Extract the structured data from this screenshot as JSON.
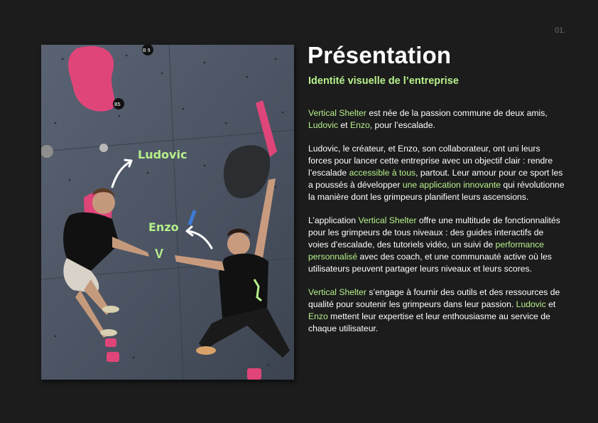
{
  "page_number": "01.",
  "title": "Présentation",
  "subtitle": "Identité visuelle de l’entreprise",
  "photo": {
    "label_ludovic": "Ludovic",
    "label_enzo": "Enzo",
    "hold_tag_b9": "B 9",
    "hold_tag_b5": "B5"
  },
  "paragraphs": [
    {
      "spans": [
        {
          "t": "Vertical Shelter",
          "h": true
        },
        {
          "t": " est née de la passion commune de deux amis, ",
          "h": false
        },
        {
          "t": "Ludovic",
          "h": true
        },
        {
          "t": " et ",
          "h": false
        },
        {
          "t": "Enzo",
          "h": true
        },
        {
          "t": ", pour l’escalade.",
          "h": false
        }
      ]
    },
    {
      "spans": [
        {
          "t": "Ludovic, le créateur, et Enzo, son collaborateur, ont uni leurs forces pour lancer cette entreprise avec un objectif clair : rendre l’escalade ",
          "h": false
        },
        {
          "t": "accessible à tous",
          "h": true
        },
        {
          "t": ", partout. Leur amour pour ce sport les a poussés à développer ",
          "h": false
        },
        {
          "t": "une application innovante",
          "h": true
        },
        {
          "t": " qui révolutionne la manière dont les grimpeurs planifient leurs ascensions.",
          "h": false
        }
      ]
    },
    {
      "spans": [
        {
          "t": "L’application ",
          "h": false
        },
        {
          "t": "Vertical Shelter",
          "h": true
        },
        {
          "t": " offre une multitude de fonctionnalités pour les grimpeurs de tous niveaux : des guides interactifs de voies d’escalade, des tutoriels vidéo, un suivi de ",
          "h": false
        },
        {
          "t": "performance personnalisé",
          "h": true
        },
        {
          "t": " avec des coach, et une communauté active où les utilisateurs peuvent partager leurs niveaux et leurs scores.",
          "h": false
        }
      ]
    },
    {
      "spans": [
        {
          "t": "Vertical Shelter",
          "h": true
        },
        {
          "t": " s’engage à fournir des outils et des ressources de qualité pour soutenir les grimpeurs dans leur passion. ",
          "h": false
        },
        {
          "t": "Ludovic",
          "h": true
        },
        {
          "t": " et ",
          "h": false
        },
        {
          "t": "Enzo",
          "h": true
        },
        {
          "t": " mettent leur expertise et leur enthousiasme au service de chaque utilisateur.",
          "h": false
        }
      ]
    }
  ],
  "colors": {
    "background": "#1c1c1c",
    "accent": "#b6f08b",
    "text": "#ffffff",
    "wall": "#4d5563",
    "hold_pink": "#e0457a"
  }
}
